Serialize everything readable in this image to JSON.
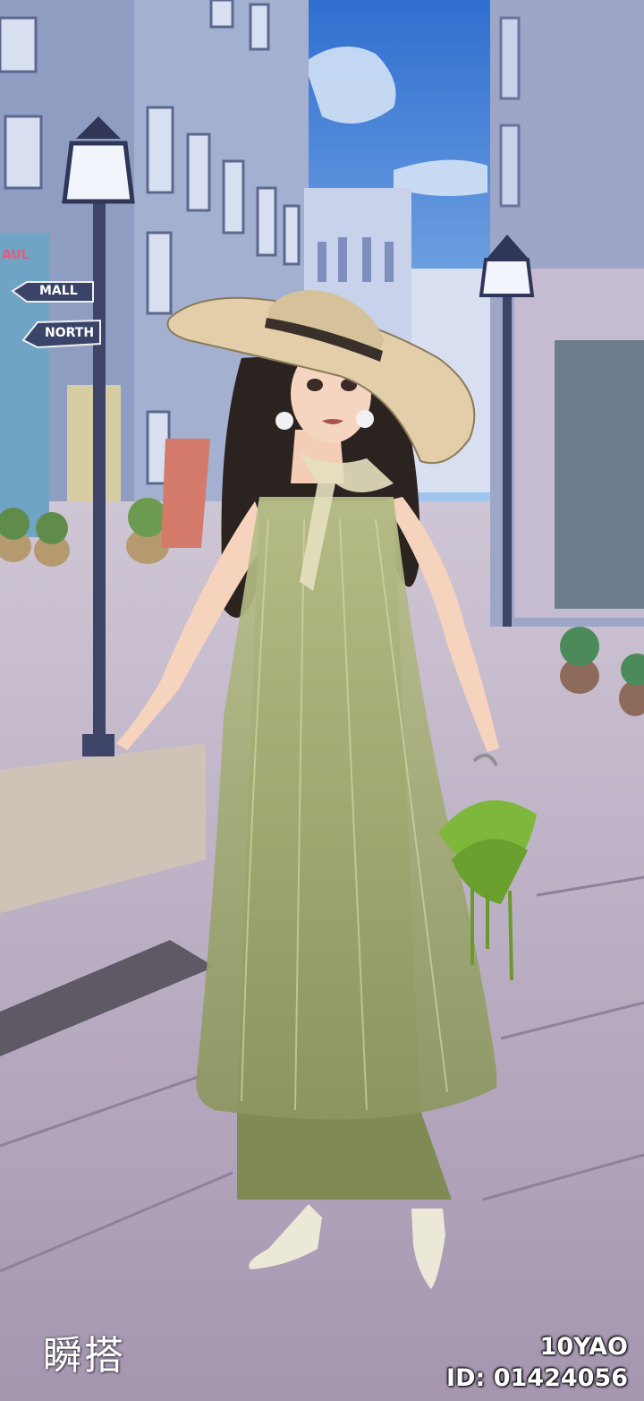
{
  "logo_text": "瞬搭",
  "player": {
    "name": "10YAO",
    "id_label": "ID:",
    "id_value": "01424056"
  },
  "street_signs": [
    "MALL",
    "NORTH"
  ],
  "shop_sign": "AUL",
  "colors": {
    "sky": "#3f7fd8",
    "pavement": "#b3a7bd",
    "dress": "#a3ad72",
    "hat": "#e2cfaa"
  }
}
